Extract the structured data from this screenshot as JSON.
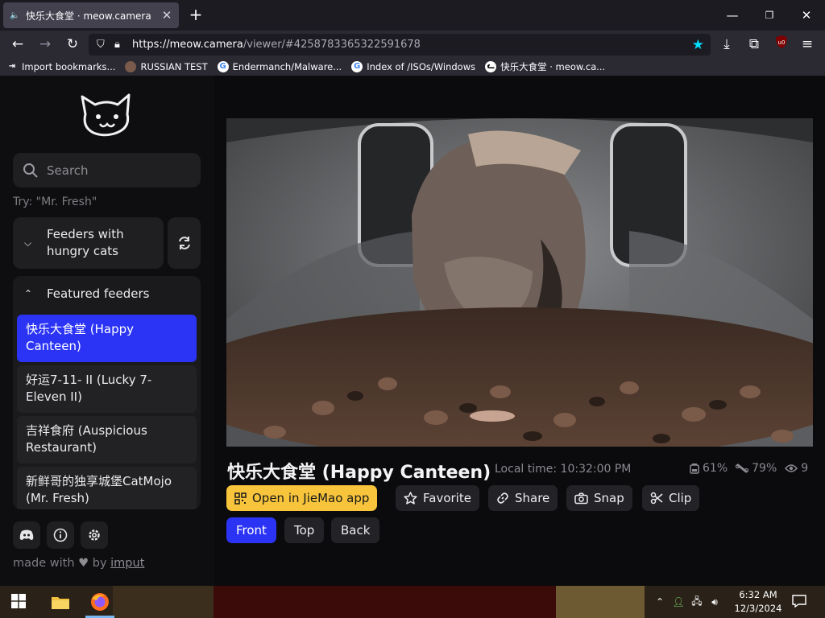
{
  "browser": {
    "tab_title": "快乐大食堂 · meow.camera",
    "tab_audio_icon": "speaker-icon",
    "url_host": "https://meow.camera",
    "url_path": "/viewer/#4258783365322591678",
    "bookmarks": [
      {
        "label": "Import bookmarks...",
        "icon": "import-icon"
      },
      {
        "label": "RUSSIAN TEST",
        "icon": "site-icon"
      },
      {
        "label": "Endermanch/Malware...",
        "icon": "google-icon"
      },
      {
        "label": "Index of /ISOs/Windows",
        "icon": "google-icon"
      },
      {
        "label": "快乐大食堂 · meow.ca...",
        "icon": "meow-icon"
      }
    ]
  },
  "sidebar": {
    "search_placeholder": "Search",
    "hint": "Try: \"Mr. Fresh\"",
    "hungry_group_line1": "Feeders with",
    "hungry_group_line2": "hungry cats",
    "featured_label": "Featured feeders",
    "feeders": [
      {
        "line1": "快乐大食堂 (Happy",
        "line2": "Canteen)",
        "active": true
      },
      {
        "line1": "好运7-11- II  (Lucky 7-",
        "line2": "Eleven II)",
        "active": false
      },
      {
        "line1": "吉祥食府 (Auspicious",
        "line2": "Restaurant)",
        "active": false
      },
      {
        "line1": "新鲜哥的独享城堡CatMojo",
        "line2": "(Mr. Fresh)",
        "active": false
      }
    ],
    "made_with_prefix": "made with",
    "made_with_by": "by",
    "made_with_link": "imput"
  },
  "viewer": {
    "title": "快乐大食堂 (Happy Canteen)",
    "local_time": "Local time: 10:32:00 PM",
    "food_level": "61%",
    "battery_level": "79%",
    "viewers": "9",
    "actions": {
      "open_app": "Open in JieMao app",
      "favorite": "Favorite",
      "share": "Share",
      "snap": "Snap",
      "clip": "Clip"
    },
    "cameras": [
      "Front",
      "Top",
      "Back"
    ],
    "active_camera": "Front"
  },
  "taskbar": {
    "time": "6:32 AM",
    "date": "12/3/2024"
  },
  "colors": {
    "accent_blue": "#2b34f5",
    "accent_yellow": "#f7c43b",
    "star_cyan": "#00ddff"
  }
}
